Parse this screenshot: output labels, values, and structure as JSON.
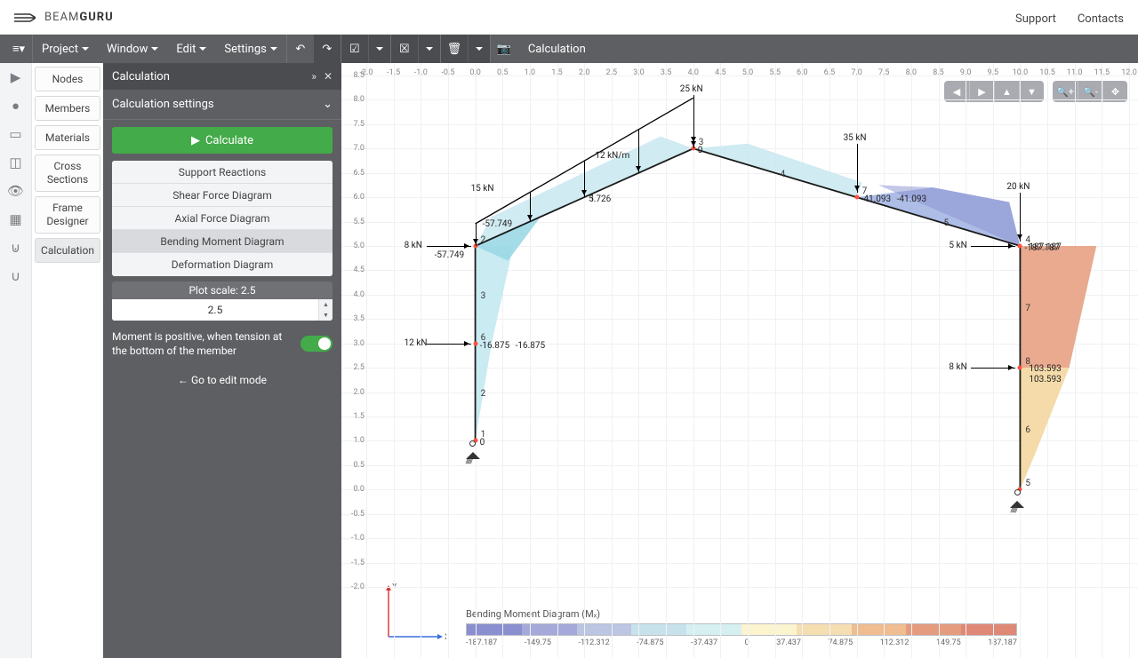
{
  "brand": {
    "prefix": "BEAM",
    "suffix": "GURU"
  },
  "topnav": {
    "support": "Support",
    "contacts": "Contacts"
  },
  "toolbar": {
    "project": "Project",
    "window": "Window",
    "edit": "Edit",
    "settings": "Settings",
    "calc": "Calculation"
  },
  "midnav": [
    "Nodes",
    "Members",
    "Materials",
    "Cross Sections",
    "Frame Designer",
    "Calculation"
  ],
  "panel": {
    "title": "Calculation",
    "sect": "Calculation settings",
    "calcBtn": "Calculate",
    "items": [
      "Support Reactions",
      "Shear Force Diagram",
      "Axial Force Diagram",
      "Bending Moment Diagram",
      "Deformation Diagram"
    ],
    "plotScaleLabel": "Plot scale: 2.5",
    "plotScaleVal": "2.5",
    "toggleLabel": "Moment is positive, when tension at the bottom of the member",
    "editMode": "← Go to edit mode"
  },
  "chart_data": {
    "type": "frame-bending-moment",
    "title": "Bending Moment Diagram (Mₓ)",
    "xrange": [
      -2.0,
      12.0
    ],
    "yrange": [
      -2.0,
      8.5
    ],
    "xticks": [
      -2.0,
      -1.5,
      -1.0,
      -0.5,
      0.0,
      0.5,
      1.0,
      1.5,
      2.0,
      2.5,
      3.0,
      3.5,
      4.0,
      4.5,
      5.0,
      5.5,
      6.0,
      6.5,
      7.0,
      7.5,
      8.0,
      8.5,
      9.0,
      9.5,
      10.0,
      10.5,
      11.0,
      11.5,
      12.0
    ],
    "yticks": [
      8.5,
      8.0,
      7.5,
      7.0,
      6.5,
      6.0,
      5.5,
      5.0,
      4.5,
      4.0,
      3.5,
      3.0,
      2.5,
      2.0,
      1.5,
      1.0,
      0.5,
      0.0,
      -0.5,
      -1.0,
      -1.5,
      -2.0
    ],
    "nodes": [
      {
        "id": 1,
        "x": 0.0,
        "y": 1.0
      },
      {
        "id": 2,
        "x": 0.0,
        "y": 5.0
      },
      {
        "id": 3,
        "x": 4.0,
        "y": 7.0
      },
      {
        "id": 4,
        "x": 10.0,
        "y": 5.0
      },
      {
        "id": 5,
        "x": 10.0,
        "y": 0.0
      }
    ],
    "intermediate_nodes": [
      {
        "id": 6,
        "x": 0.0,
        "y": 3.0
      },
      {
        "id": 7,
        "x": 7.0,
        "y": 6.0
      },
      {
        "id": 8,
        "x": 10.0,
        "y": 2.5
      }
    ],
    "members": [
      {
        "id": 2,
        "from": 1,
        "to": 6
      },
      {
        "id": 3,
        "from": 6,
        "to": 2
      },
      {
        "id": 1,
        "from": 2,
        "to": 3
      },
      {
        "id": 4,
        "from": 3,
        "to": 7
      },
      {
        "id": 5,
        "from": 7,
        "to": 4
      },
      {
        "id": 7,
        "from": 4,
        "to": 8
      },
      {
        "id": 6,
        "from": 8,
        "to": 5
      }
    ],
    "loads": [
      {
        "type": "point",
        "dir": "down",
        "x": 4.0,
        "y": 7.0,
        "mag": "25 kN"
      },
      {
        "type": "point",
        "dir": "down",
        "x": 7.0,
        "y": 6.0,
        "mag": "35 kN"
      },
      {
        "type": "point",
        "dir": "down",
        "x": 10.0,
        "y": 5.0,
        "mag": "20 kN"
      },
      {
        "type": "point",
        "dir": "right",
        "x": 0.0,
        "y": 5.0,
        "mag": "8 kN",
        "side": "left"
      },
      {
        "type": "point",
        "dir": "right",
        "x": 0.0,
        "y": 3.0,
        "mag": "12 kN",
        "side": "left"
      },
      {
        "type": "point",
        "dir": "right",
        "x": 10.0,
        "y": 5.0,
        "mag": "5 kN",
        "side": "left"
      },
      {
        "type": "point",
        "dir": "right",
        "x": 10.0,
        "y": 2.5,
        "mag": "8 kN",
        "side": "left"
      },
      {
        "type": "distributed",
        "from": {
          "x": 0.0,
          "y": 5.0
        },
        "to": {
          "x": 4.0,
          "y": 7.0
        },
        "mag": "12 kN/m",
        "peak": "15 kN"
      }
    ],
    "moment_values": [
      {
        "x": 0.0,
        "y": 5.0,
        "v": -57.749,
        "side": "top"
      },
      {
        "x": 0.0,
        "y": 5.0,
        "v": -57.749,
        "side": "bottom"
      },
      {
        "x": 2.0,
        "y": 6.0,
        "v": 5.726
      },
      {
        "x": 4.0,
        "y": 7.0,
        "v": 0
      },
      {
        "x": 7.0,
        "y": 6.0,
        "v": -41.093,
        "dup": -41.093
      },
      {
        "x": 10.0,
        "y": 5.0,
        "v": -187.187
      },
      {
        "x": 10.0,
        "y": 5.0,
        "v": 187.187,
        "side": "right"
      },
      {
        "x": 10.0,
        "y": 2.5,
        "v": 103.593,
        "side": "right"
      },
      {
        "x": 10.0,
        "y": 2.5,
        "v": 103.593,
        "side": "rightbelow"
      },
      {
        "x": 0.0,
        "y": 3.0,
        "v": -16.875,
        "dup": -16.875
      },
      {
        "x": 0.0,
        "y": 1.0,
        "v": 0
      }
    ],
    "legend_ticks": [
      "-187.187",
      "-149.75",
      "-112.312",
      "-74.875",
      "-37.437",
      "0",
      "37.437",
      "74.875",
      "112.312",
      "149.75",
      "187.187"
    ],
    "legend_colors": [
      "#8a8fd0",
      "#a4a9d9",
      "#bcc5e2",
      "#c8e2ec",
      "#d6f0f2",
      "#fcf4cf",
      "#f6deb3",
      "#efbd90",
      "#e59c7e",
      "#df8875"
    ]
  }
}
